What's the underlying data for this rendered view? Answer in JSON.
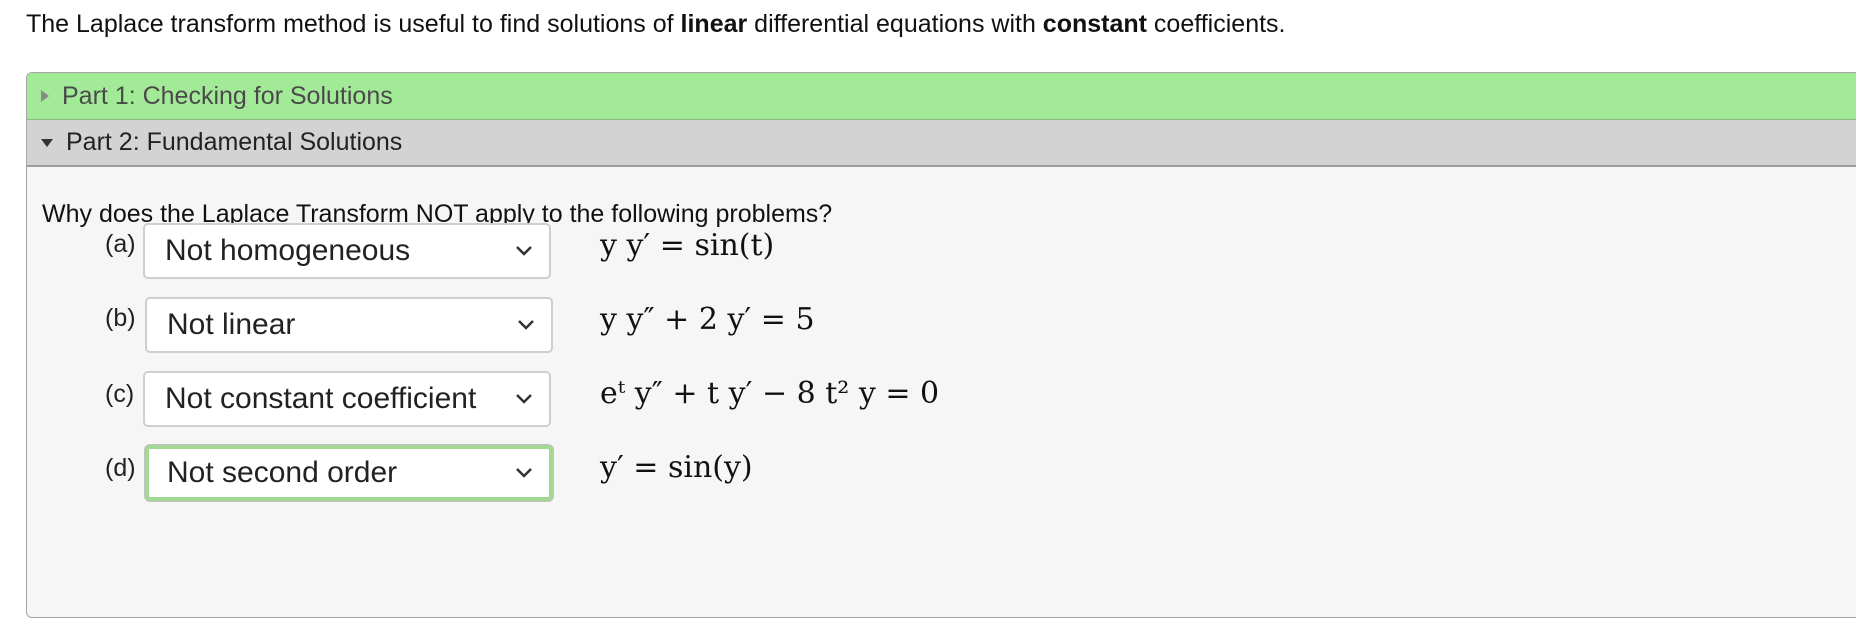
{
  "intro": {
    "part1": "The Laplace transform method is useful to find solutions of ",
    "bold1": "linear",
    "part2": " differential equations with ",
    "bold2": "constant",
    "part3": " coefficients."
  },
  "accordion": {
    "sections": [
      {
        "title": "Part 1: Checking for Solutions",
        "expanded": false,
        "color": "#a3ea98"
      },
      {
        "title": "Part 2: Fundamental Solutions",
        "expanded": true,
        "color": "#d3d3d3"
      }
    ],
    "question": "Why does the Laplace Transform NOT apply to the following problems?",
    "items": [
      {
        "label": "(a)",
        "selected": "Not homogeneous",
        "equation": "y y′ = sin(t)"
      },
      {
        "label": "(b)",
        "selected": "Not linear",
        "equation": "y y″ + 2 y′ = 5"
      },
      {
        "label": "(c)",
        "selected": "Not constant coefficient",
        "equation": "eᵗ y″ + t y′ − 8 t² y = 0"
      },
      {
        "label": "(d)",
        "selected": "Not second order",
        "equation": "y′ = sin(y)"
      }
    ]
  },
  "icons": {
    "collapsed": "triangle-right-icon",
    "expanded": "triangle-down-icon",
    "select": "chevron-down-icon"
  },
  "colors": {
    "focus_ring": "#a4d994"
  }
}
